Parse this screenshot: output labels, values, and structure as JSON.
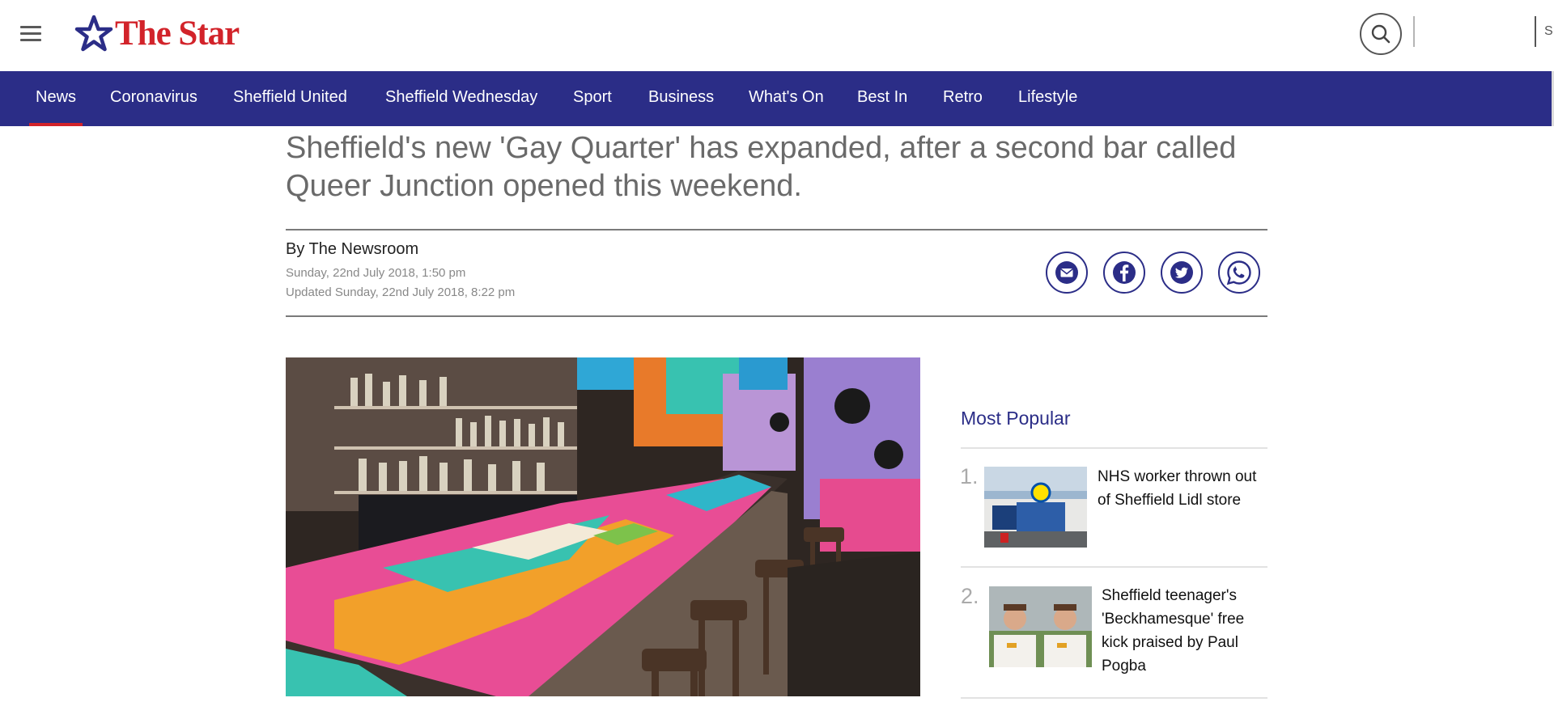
{
  "header": {
    "brand_name": "The Star",
    "signin_partial": "S"
  },
  "nav": {
    "items": [
      {
        "label": "News",
        "active": true
      },
      {
        "label": "Coronavirus"
      },
      {
        "label": "Sheffield United"
      },
      {
        "label": "Sheffield Wednesday"
      },
      {
        "label": "Sport"
      },
      {
        "label": "Business"
      },
      {
        "label": "What's On"
      },
      {
        "label": "Best In"
      },
      {
        "label": "Retro"
      },
      {
        "label": "Lifestyle"
      }
    ]
  },
  "article": {
    "headline": "Sheffield's new 'Gay Quarter' has expanded, after a second bar called Queer Junction opened this weekend.",
    "byline": "By The Newsroom",
    "published": "Sunday, 22nd July 2018, 1:50 pm",
    "updated": "Updated  Sunday, 22nd July 2018, 8:22 pm"
  },
  "share": [
    "email-icon",
    "facebook-icon",
    "twitter-icon",
    "whatsapp-icon"
  ],
  "sidebar": {
    "title": "Most Popular",
    "items": [
      {
        "rank": "1.",
        "title": "NHS worker thrown out of Sheffield Lidl store"
      },
      {
        "rank": "2.",
        "title": "Sheffield teenager's 'Beckhamesque' free kick praised by Paul Pogba"
      }
    ]
  },
  "colors": {
    "brand_red": "#d2232a",
    "nav_blue": "#2b2d87"
  }
}
